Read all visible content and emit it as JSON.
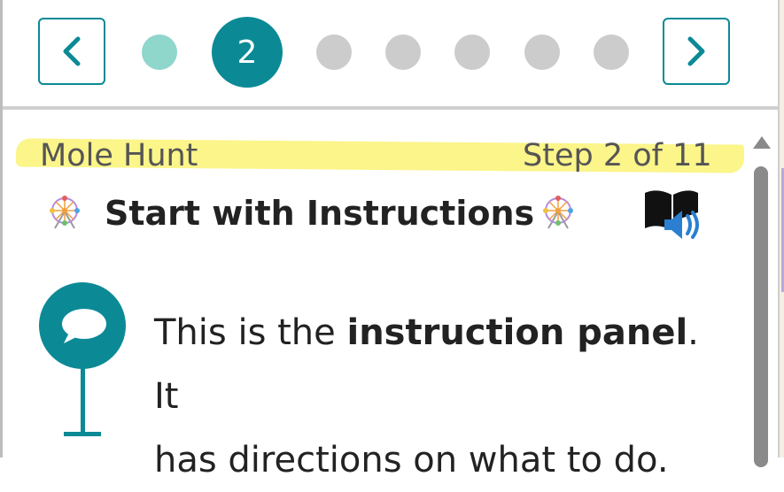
{
  "nav": {
    "prev_label": "Previous step",
    "next_label": "Next step",
    "current_step": "2",
    "dots": [
      "visited",
      "current",
      "upcoming",
      "upcoming",
      "upcoming",
      "upcoming",
      "upcoming"
    ]
  },
  "panel": {
    "mission": "Mole Hunt",
    "step_indicator": "Step 2 of 11",
    "title": "Start with Instructions",
    "title_icon": "ferris-wheel-icon",
    "audio_icon": "read-aloud-icon",
    "instruction_line_1_pre": "This is the ",
    "instruction_bold": "instruction panel",
    "instruction_line_1_post": ". It",
    "instruction_line_2": "has directions on what to do."
  },
  "colors": {
    "accent": "#0b8a96",
    "visited_dot": "#8fd6cb",
    "upcoming_dot": "#cccccc",
    "highlight": "#fbf58a"
  }
}
